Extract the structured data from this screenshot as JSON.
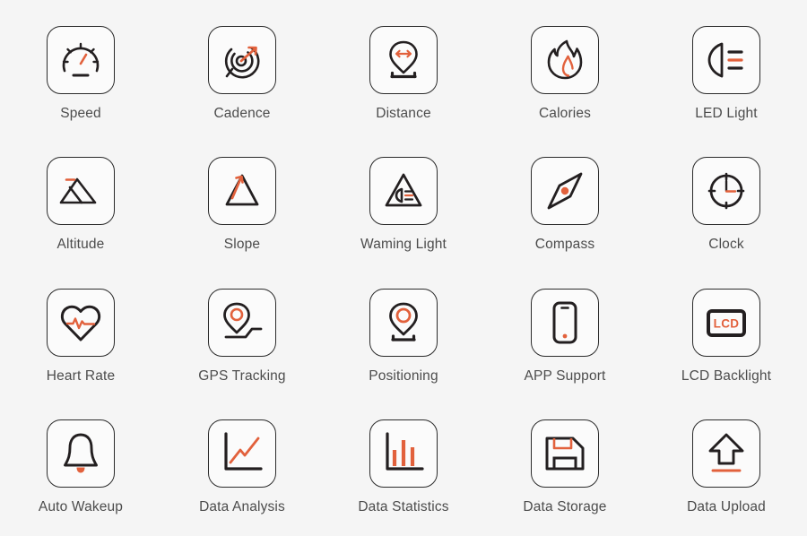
{
  "page": {
    "title": "Bike Computer Feature Icons",
    "background_color": "#f5f5f5",
    "icon_outline_color": "#231f20",
    "accent_color": "#e2613c",
    "label_color": "#4c4c4c",
    "columns": 5,
    "rows": 4
  },
  "features": [
    {
      "label": "Speed",
      "icon": "speedometer-icon"
    },
    {
      "label": "Cadence",
      "icon": "cadence-gauge-icon"
    },
    {
      "label": "Distance",
      "icon": "distance-pin-icon"
    },
    {
      "label": "Calories",
      "icon": "flame-icon"
    },
    {
      "label": "LED Light",
      "icon": "headlight-icon"
    },
    {
      "label": "Altitude",
      "icon": "mountain-icon"
    },
    {
      "label": "Slope",
      "icon": "slope-triangle-icon"
    },
    {
      "label": "Waming Light",
      "icon": "warning-headlight-triangle-icon"
    },
    {
      "label": "Compass",
      "icon": "compass-diamond-icon"
    },
    {
      "label": "Clock",
      "icon": "clock-icon"
    },
    {
      "label": "Heart Rate",
      "icon": "heart-pulse-icon"
    },
    {
      "label": "GPS Tracking",
      "icon": "gps-route-pin-icon"
    },
    {
      "label": "Positioning",
      "icon": "location-pin-icon"
    },
    {
      "label": "APP Support",
      "icon": "smartphone-icon"
    },
    {
      "label": "LCD Backlight",
      "icon": "lcd-screen-icon",
      "screen_text": "LCD"
    },
    {
      "label": "Auto Wakeup",
      "icon": "bell-icon"
    },
    {
      "label": "Data Analysis",
      "icon": "line-chart-icon"
    },
    {
      "label": "Data Statistics",
      "icon": "bar-chart-icon"
    },
    {
      "label": "Data Storage",
      "icon": "floppy-disk-icon"
    },
    {
      "label": "Data Upload",
      "icon": "upload-arrow-icon"
    }
  ]
}
